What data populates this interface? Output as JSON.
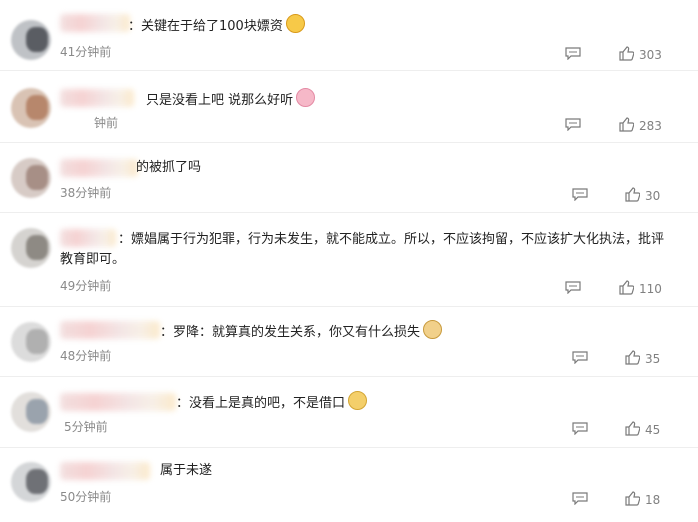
{
  "comments": [
    {
      "text": "：关键在于给了100块嫖资",
      "emoji": "laughing-emoji",
      "time": "41分钟前",
      "likes": "303"
    },
    {
      "text": "只是没看上吧 说那么好听",
      "emoji": "pig-emoji",
      "time": "钟前",
      "likes": "283"
    },
    {
      "text": "的被抓了吗",
      "emoji": "",
      "time": "38分钟前",
      "likes": "30"
    },
    {
      "text": "：嫖娼属于行为犯罪，行为未发生，就不能成立。所以，不应该拘留，不应该扩大化执法，批评教育即可。",
      "emoji": "",
      "time": "49分钟前",
      "likes": "110"
    },
    {
      "text": "：罗降：就算真的发生关系，你又有什么损失",
      "emoji": "doge-emoji",
      "time": "48分钟前",
      "likes": "35"
    },
    {
      "text": "：没看上是真的吧，不是借口",
      "emoji": "clap-emoji",
      "time": "5分钟前",
      "likes": "45"
    },
    {
      "text": "属于未遂",
      "emoji": "",
      "time": "50分钟前",
      "likes": "18"
    }
  ],
  "colors": {
    "text": "#222222",
    "meta": "#8a8a8a",
    "icon": "#7a7a7a"
  }
}
